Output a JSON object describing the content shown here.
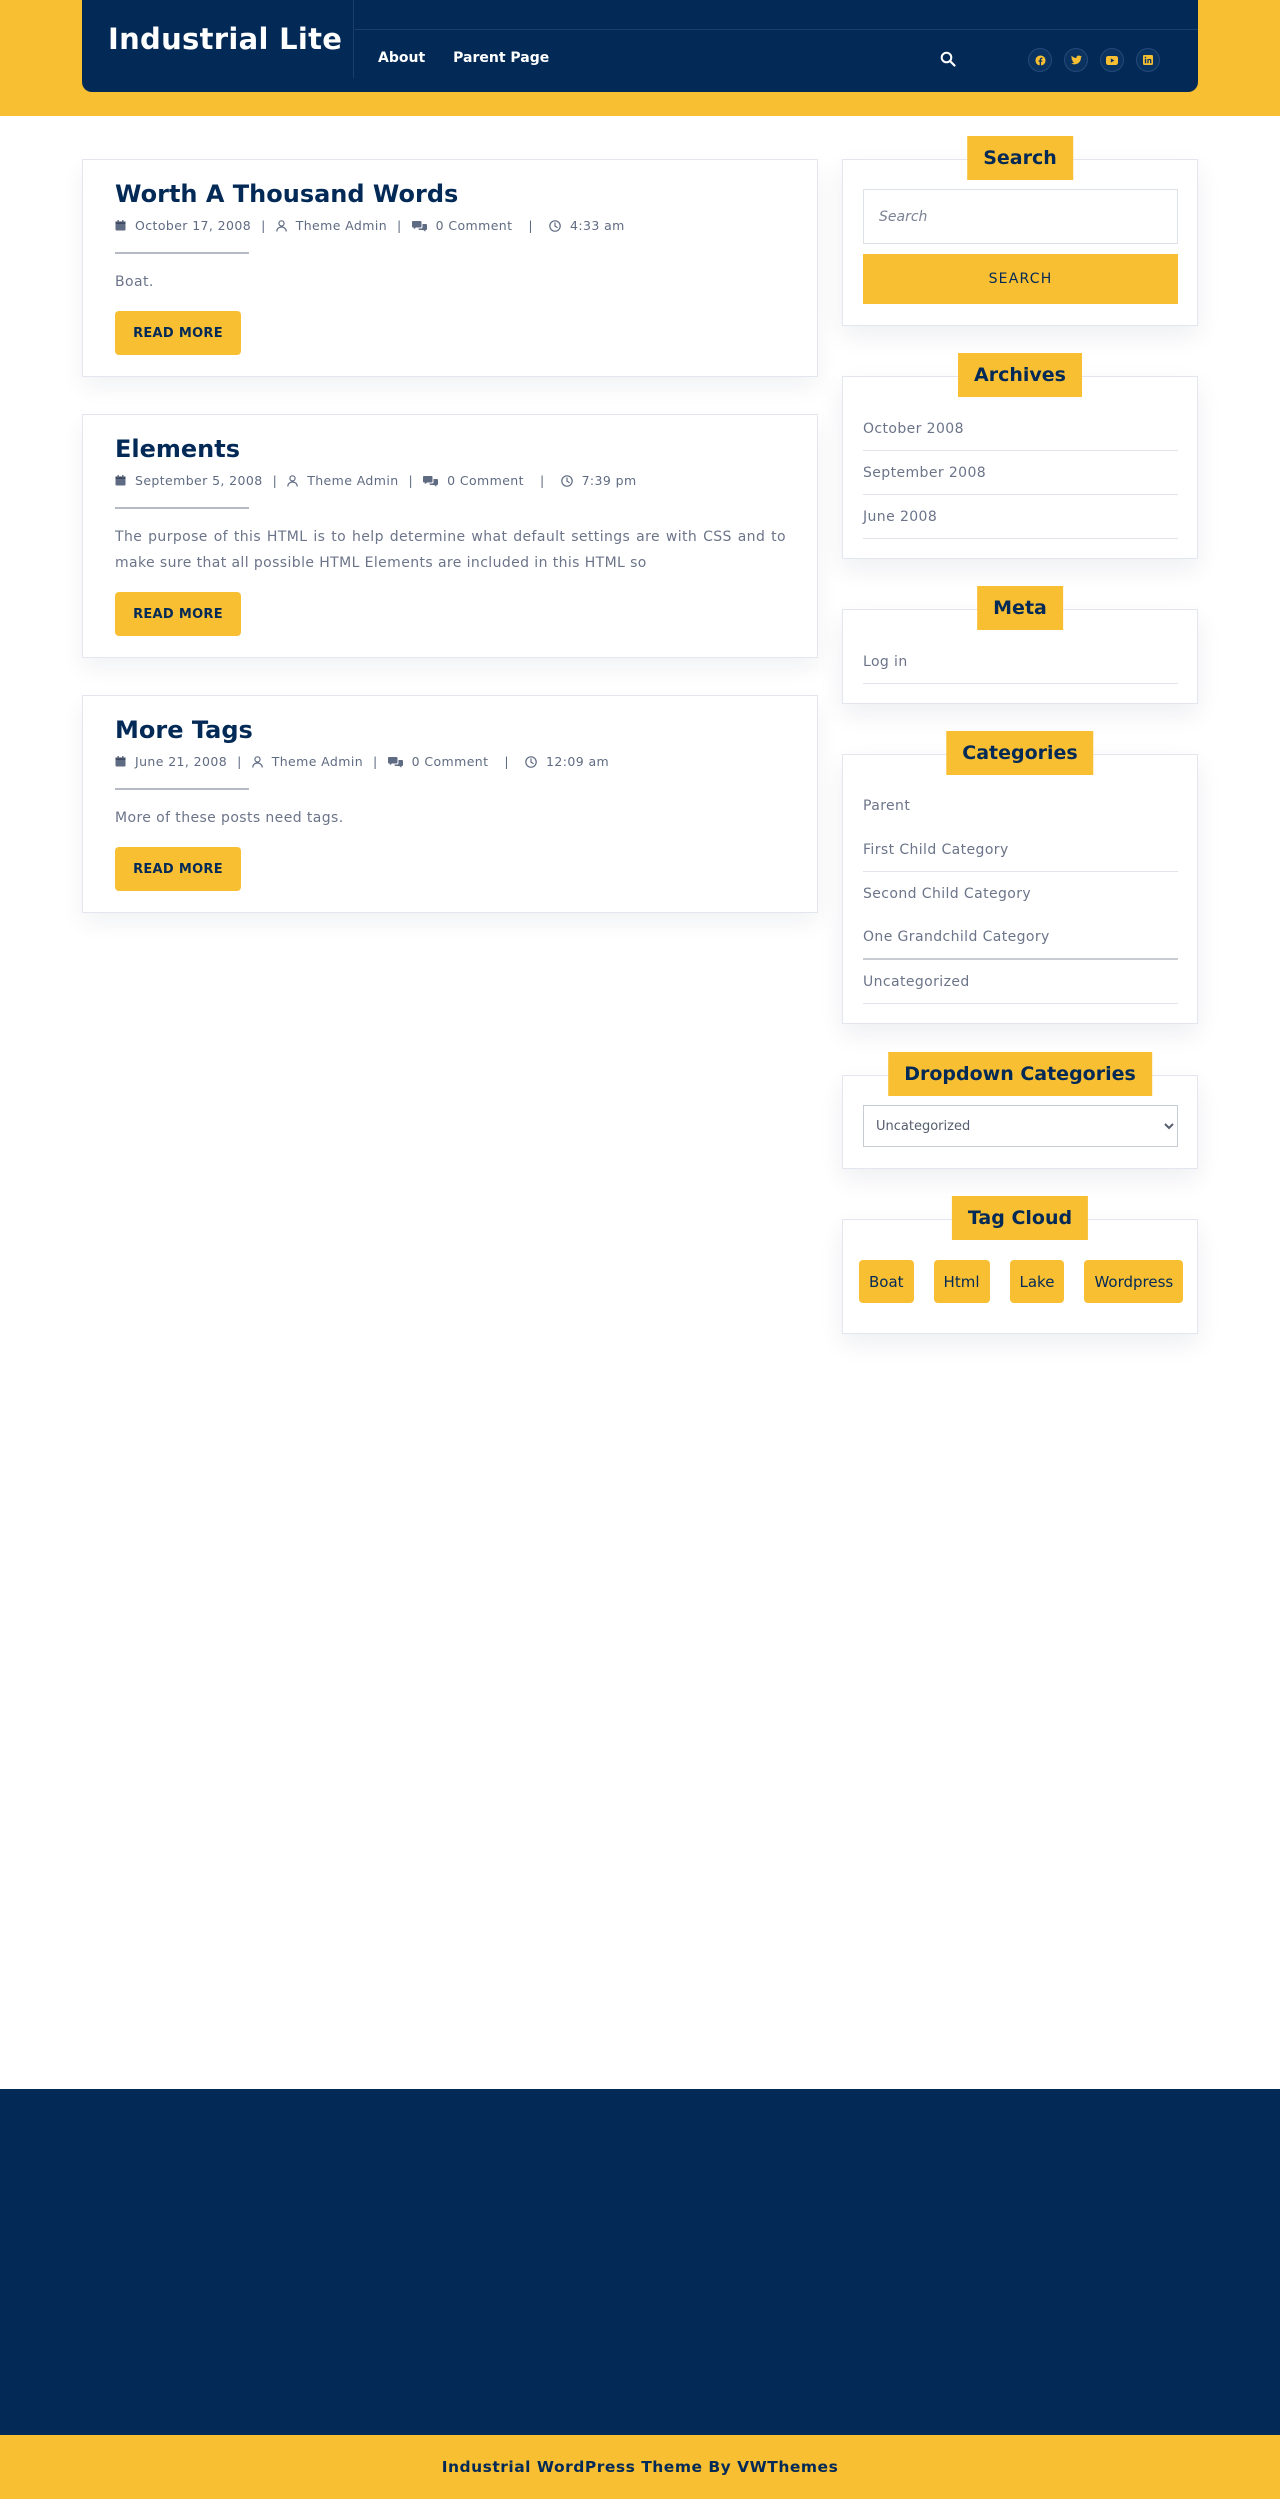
{
  "colors": {
    "navy": "#032a57",
    "yellow": "#f8bf32",
    "text": "#6b7489"
  },
  "header": {
    "site_title": "Industrial Lite",
    "nav": [
      {
        "label": "About"
      },
      {
        "label": "Parent Page"
      }
    ],
    "search_icon": "search-icon",
    "socials": [
      {
        "icon": "facebook-icon"
      },
      {
        "icon": "twitter-icon"
      },
      {
        "icon": "youtube-icon"
      },
      {
        "icon": "linkedin-icon"
      }
    ]
  },
  "posts": [
    {
      "title": "Worth A Thousand Words",
      "date": "October 17, 2008",
      "author": "Theme Admin",
      "comments": "0 Comment",
      "time": "4:33 am",
      "excerpt": "Boat.",
      "button": "READ MORE"
    },
    {
      "title": "Elements",
      "date": "September 5, 2008",
      "author": "Theme Admin",
      "comments": "0 Comment",
      "time": "7:39 pm",
      "excerpt": "The purpose of this HTML is to help determine what default settings are with CSS and to make sure that all possible HTML Elements are included in this HTML so",
      "button": "READ MORE"
    },
    {
      "title": "More Tags",
      "date": "June 21, 2008",
      "author": "Theme Admin",
      "comments": "0 Comment",
      "time": "12:09 am",
      "excerpt": "More of these posts need tags.",
      "button": "READ MORE"
    }
  ],
  "sidebar": {
    "search": {
      "title": "Search",
      "placeholder": "Search",
      "button": "SEARCH"
    },
    "archives": {
      "title": "Archives",
      "items": [
        "October 2008",
        "September 2008",
        "June 2008"
      ]
    },
    "meta": {
      "title": "Meta",
      "items": [
        "Log in"
      ]
    },
    "categories": {
      "title": "Categories",
      "items": [
        "Parent",
        "First Child Category",
        "Second Child Category",
        "One Grandchild Category",
        "Uncategorized"
      ]
    },
    "dropdown": {
      "title": "Dropdown Categories",
      "selected": "Uncategorized"
    },
    "tag_cloud": {
      "title": "Tag Cloud",
      "tags": [
        "Boat",
        "Html",
        "Lake",
        "Wordpress"
      ]
    }
  },
  "footer": {
    "copyright": "Industrial WordPress Theme By VWThemes"
  }
}
